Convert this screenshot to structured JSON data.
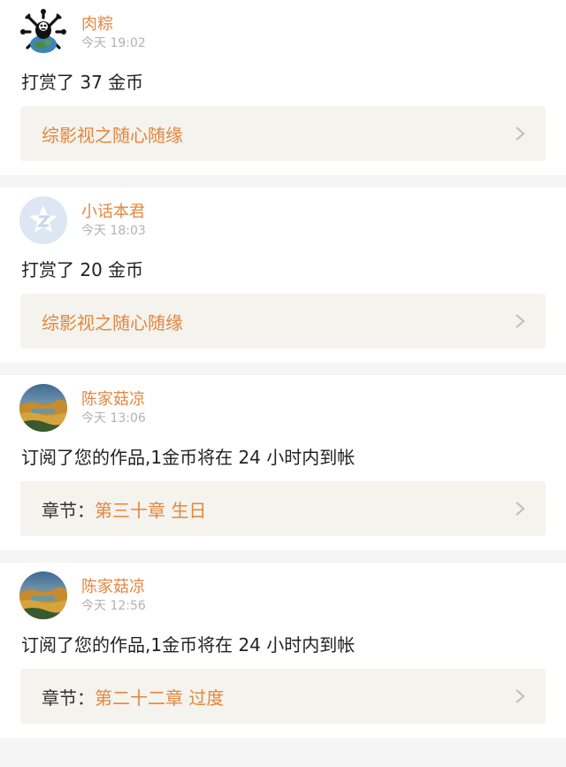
{
  "feed": [
    {
      "avatar": "skull-avatar",
      "name": "肉粽",
      "time": "今天 19:02",
      "message": "打赏了 37 金币",
      "link_label": "",
      "link_title": "综影视之随心随缘"
    },
    {
      "avatar": "qq-default-avatar",
      "name": "小话本君",
      "time": "今天 18:03",
      "message": "打赏了 20 金币",
      "link_label": "",
      "link_title": "综影视之随心随缘"
    },
    {
      "avatar": "landscape-photo-avatar",
      "name": "陈家菇凉",
      "time": "今天 13:06",
      "message": "订阅了您的作品,1金币将在 24 小时内到帐",
      "link_label": "章节：",
      "link_title": "第三十章 生日"
    },
    {
      "avatar": "landscape-photo-avatar",
      "name": "陈家菇凉",
      "time": "今天 12:56",
      "message": "订阅了您的作品,1金币将在 24 小时内到帐",
      "link_label": "章节：",
      "link_title": "第二十二章 过度"
    }
  ],
  "colors": {
    "accent": "#e4863e",
    "link_bg": "#f4f3ed",
    "separator": "#f5f5f5",
    "muted": "#b2b2b2"
  }
}
